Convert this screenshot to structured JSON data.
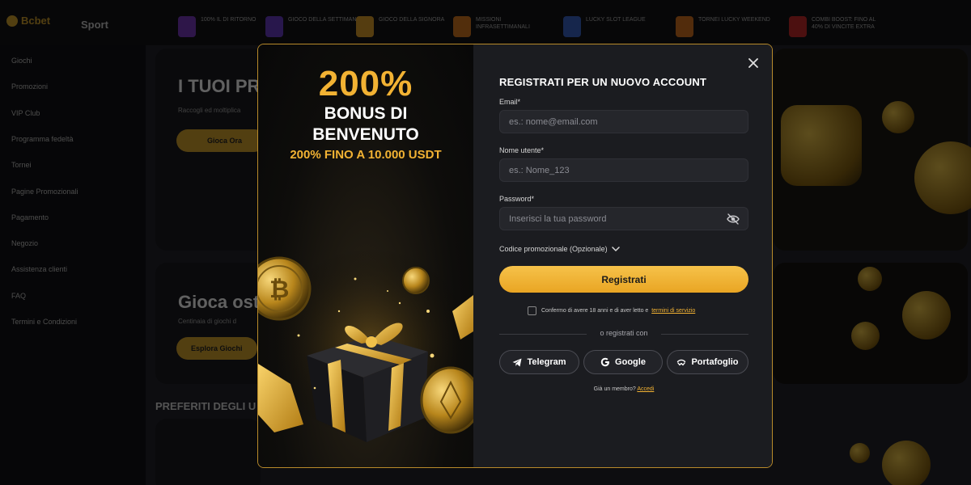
{
  "background": {
    "logo_text": "Bcbet",
    "sport_tab": "Sport",
    "promos": [
      {
        "text": "100% IL DI RITORNO",
        "color": "#7a3bbf"
      },
      {
        "text": "GIOCO DELLA SETTIMANA",
        "color": "#6a3dc9"
      },
      {
        "text": "GIOCO DELLA SIGNORA",
        "color": "#e0a12a"
      },
      {
        "text": "MISSIONI INFRASETTIMANALI",
        "color": "#d97a1f"
      },
      {
        "text": "LUCKY SLOT LEAGUE",
        "color": "#3a63c9"
      },
      {
        "text": "TORNEI LUCKY WEEKEND",
        "color": "#d9741f"
      },
      {
        "text": "COMBI BOOST: FINO AL 40% DI VINCITE EXTRA",
        "color": "#c92a2a"
      }
    ],
    "sidebar": [
      "Giochi",
      "Promozioni",
      "VIP Club",
      "Programma fedeltà",
      "Tornei",
      "Pagine Promozionali",
      "Pagamento",
      "Negozio",
      "Assistenza clienti",
      "FAQ",
      "Termini e Condizioni"
    ],
    "hero_title": "I TUOI PR",
    "hero_sub": "Raccogli ed moltiplica",
    "hero_btn": "Gioca Ora",
    "card2_title": "Gioca ost",
    "card2_sub": "Centinaia di giochi d",
    "card2_btn": "Esplora Giochi",
    "section_title": "PREFERITI DEGLI U"
  },
  "promo_panel": {
    "percent": "200%",
    "line1": "BONUS DI",
    "line2": "BENVENUTO",
    "subline": "200% FINO A 10.000 USDT"
  },
  "form": {
    "title": "REGISTRATI PER UN NUOVO ACCOUNT",
    "email_label": "Email*",
    "email_placeholder": "es.: nome@email.com",
    "username_label": "Nome utente*",
    "username_placeholder": "es.: Nome_123",
    "password_label": "Password*",
    "password_placeholder": "Inserisci la tua password",
    "promo_code_label": "Codice promozionale (Opzionale)",
    "register_label": "Registrati",
    "consent_text": "Confermo di avere 18 anni e di aver letto e",
    "terms_link": "termini di servizio",
    "divider_text": "o registrati con",
    "social": {
      "telegram": "Telegram",
      "google": "Google",
      "wallet": "Portafoglio"
    },
    "login_prompt": "Già un membro?",
    "login_link": "Accedi"
  },
  "colors": {
    "accent": "#f2b233",
    "modal_border": "#b88a2a"
  }
}
